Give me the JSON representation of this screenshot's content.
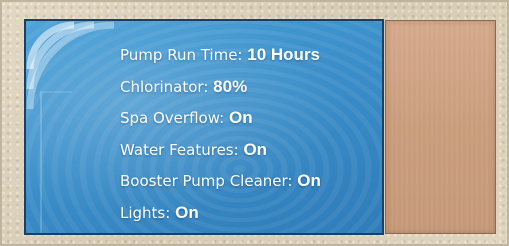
{
  "status_items": [
    {
      "label": "Pump Run Time:",
      "value": "10 Hours"
    },
    {
      "label": "Chlorinator:",
      "value": "80%"
    },
    {
      "label": "Spa Overflow:",
      "value": "On"
    },
    {
      "label": "Water Features:",
      "value": "On"
    },
    {
      "label": "Booster Pump Cleaner:",
      "value": "On"
    },
    {
      "label": "Lights:",
      "value": "On"
    }
  ],
  "colors": {
    "screen_blue": "#3b8fca",
    "screen_border": "#1c3f66",
    "text": "#ffffff",
    "side_panel": "#c99c7c",
    "frame": "#d9cfb8"
  },
  "icons": [
    "wifi-signal-arcs-icon"
  ]
}
